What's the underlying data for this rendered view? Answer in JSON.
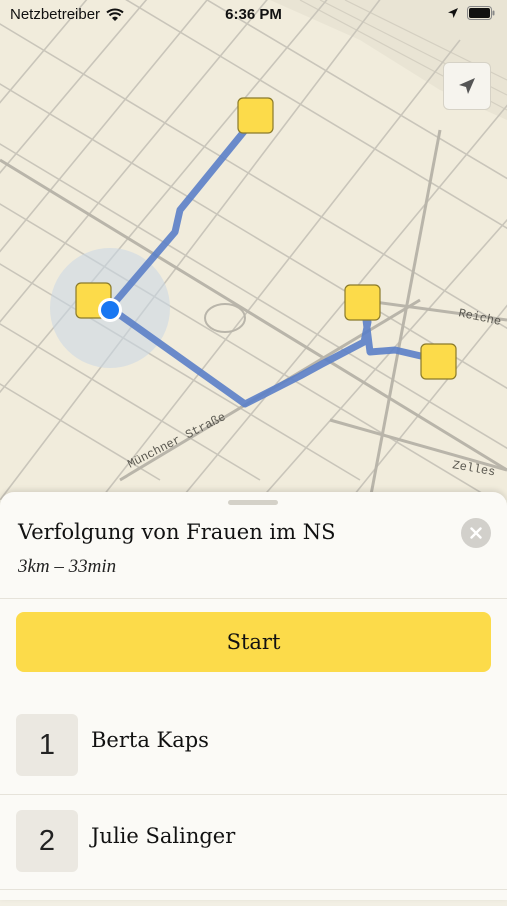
{
  "status_bar": {
    "carrier": "Netzbetreiber",
    "time": "6:36 PM"
  },
  "map": {
    "street_labels": [
      "Münchner Straße",
      "Reiche",
      "Zelles"
    ],
    "colors": {
      "route": "#5b7fc8",
      "marker": "#fcdb4a",
      "user": "#1877f2"
    }
  },
  "tour": {
    "title": "Verfolgung von Frauen im NS",
    "meta": "3km – 33min",
    "start_label": "Start"
  },
  "stops": [
    {
      "number": "1",
      "name": "Berta Kaps"
    },
    {
      "number": "2",
      "name": "Julie Salinger"
    }
  ]
}
